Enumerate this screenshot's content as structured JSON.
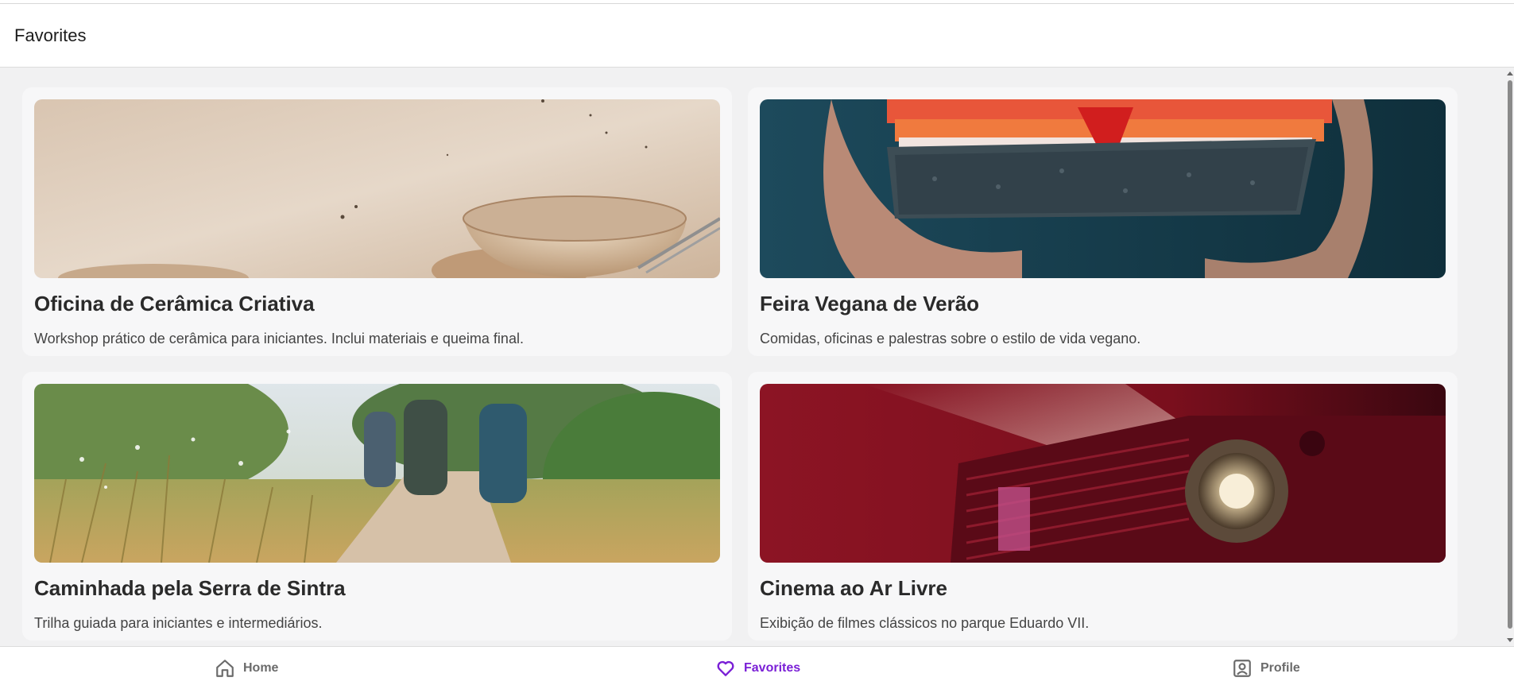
{
  "header": {
    "title": "Favorites"
  },
  "cards": [
    {
      "title": "Oficina de Cerâmica Criativa",
      "description": "Workshop prático de cerâmica para iniciantes. Inclui materiais e queima final.",
      "image_icon": "ceramic-bowls-image"
    },
    {
      "title": "Feira Vegana de Verão",
      "description": "Comidas, oficinas e palestras sobre o estilo de vida vegano.",
      "image_icon": "vegan-sandwich-image"
    },
    {
      "title": "Caminhada pela Serra de Sintra",
      "description": "Trilha guiada para iniciantes e intermediários.",
      "image_icon": "hiking-trail-image"
    },
    {
      "title": "Cinema ao Ar Livre",
      "description": "Exibição de filmes clássicos no parque Eduardo VII.",
      "image_icon": "projector-image"
    }
  ],
  "nav": {
    "items": [
      {
        "label": "Home",
        "icon": "home-icon",
        "active": false
      },
      {
        "label": "Favorites",
        "icon": "heart-icon",
        "active": true
      },
      {
        "label": "Profile",
        "icon": "profile-icon",
        "active": false
      }
    ],
    "active_color": "#7a1fd6",
    "inactive_color": "#6b6b6b"
  }
}
